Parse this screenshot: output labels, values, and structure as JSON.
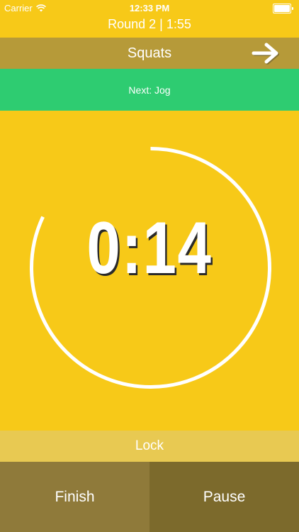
{
  "status_bar": {
    "carrier": "Carrier",
    "time": "12:33 PM",
    "battery_level": 1.0
  },
  "round": {
    "label": "Round 2 | 1:55"
  },
  "exercise": {
    "name": "Squats",
    "next_icon": "arrow-right-icon"
  },
  "next_up": {
    "label": "Next: Jog"
  },
  "timer": {
    "display": "0:14",
    "progress": 0.82
  },
  "controls": {
    "lock_label": "Lock",
    "finish_label": "Finish",
    "pause_label": "Pause"
  },
  "colors": {
    "background": "#f7c918",
    "exercise_bar": "#b69a39",
    "next_bar": "#2ecc71",
    "lock_bar": "#e8c952",
    "finish_button": "#8f7a3a",
    "pause_button": "#7c6a2c"
  }
}
